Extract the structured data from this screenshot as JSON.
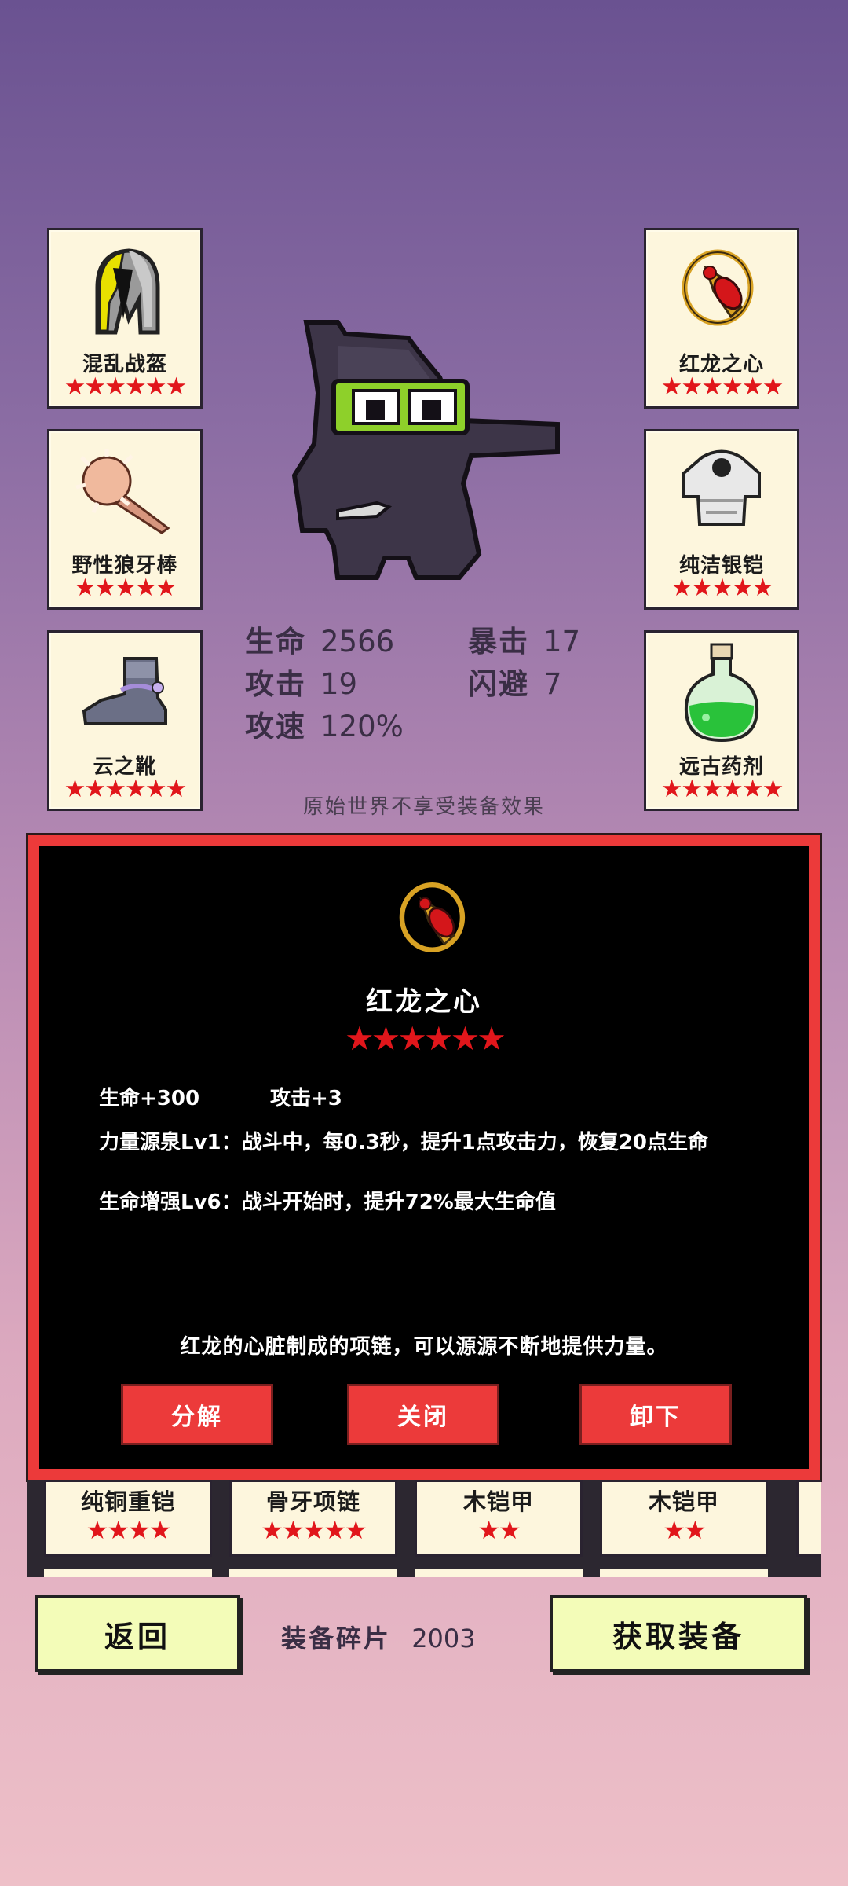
{
  "slots_left": [
    {
      "name": "混乱战盔",
      "stars": "★★★★★★",
      "icon": "helmet-icon"
    },
    {
      "name": "野性狼牙棒",
      "stars": "★★★★★",
      "icon": "club-icon"
    },
    {
      "name": "云之靴",
      "stars": "★★★★★★",
      "icon": "boots-icon"
    }
  ],
  "slots_right": [
    {
      "name": "红龙之心",
      "stars": "★★★★★★",
      "icon": "necklace-icon"
    },
    {
      "name": "纯洁银铠",
      "stars": "★★★★★",
      "icon": "armor-icon"
    },
    {
      "name": "远古药剂",
      "stars": "★★★★★★",
      "icon": "potion-icon"
    }
  ],
  "stats": {
    "hp_label": "生命",
    "hp": "2566",
    "crit_label": "暴击",
    "crit": "17",
    "atk_label": "攻击",
    "atk": "19",
    "dodge_label": "闪避",
    "dodge": "7",
    "speed_label": "攻速",
    "speed": "120%"
  },
  "note": "原始世界不享受装备效果",
  "detail": {
    "icon": "necklace-icon",
    "title": "红龙之心",
    "stars": "★★★★★★",
    "attr1": "生命+300",
    "attr2": "攻击+3",
    "skill1": "力量源泉Lv1：战斗中，每0.3秒，提升1点攻击力，恢复20点生命",
    "skill2": "生命增强Lv6：战斗开始时，提升72%最大生命值",
    "description": "红龙的心脏制成的项链，可以源源不断地提供力量。",
    "btn_decompose": "分解",
    "btn_close": "关闭",
    "btn_unequip": "卸下"
  },
  "inventory": [
    {
      "name": "纯铜重铠",
      "stars": "★★★★"
    },
    {
      "name": "骨牙项链",
      "stars": "★★★★★"
    },
    {
      "name": "木铠甲",
      "stars": "★★"
    },
    {
      "name": "木铠甲",
      "stars": "★★"
    }
  ],
  "footer": {
    "back": "返回",
    "fragments_label": "装备碎片",
    "fragments_value": "2003",
    "get_equipment": "获取装备"
  },
  "colors": {
    "star": "#e1161b",
    "panel_border": "#ec3a3a",
    "button_bg": "#f3fcb8"
  }
}
